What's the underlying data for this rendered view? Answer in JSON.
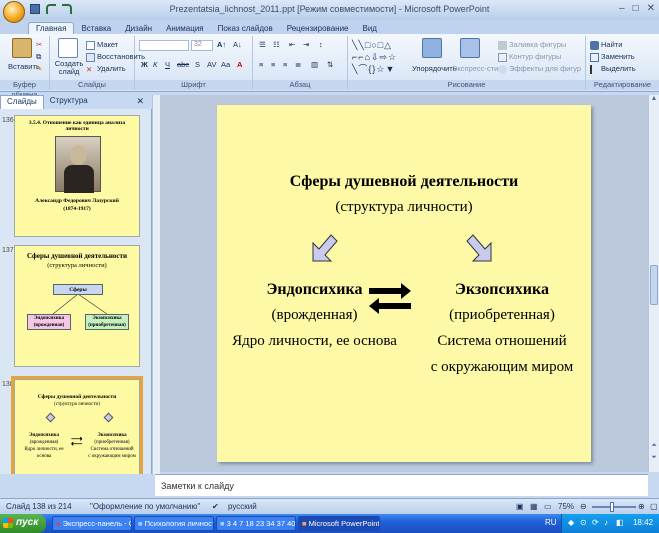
{
  "window": {
    "title": "Prezentatsia_lichnost_2011.ppt [Режим совместимости] - Microsoft PowerPoint",
    "controls": [
      "–",
      "□",
      "✕"
    ]
  },
  "ribbon": {
    "tabs": [
      "Главная",
      "Вставка",
      "Дизайн",
      "Анимация",
      "Показ слайдов",
      "Рецензирование",
      "Вид"
    ],
    "active_tab": "Главная",
    "clipboard": {
      "paste": "Вставить",
      "group": "Буфер обмена"
    },
    "slides": {
      "create": "Создать слайд",
      "layout": "Макет",
      "reset": "Восстановить",
      "delete": "Удалить",
      "group": "Слайды"
    },
    "font": {
      "size": "32",
      "group": "Шрифт"
    },
    "paragraph": {
      "group": "Абзац"
    },
    "drawing": {
      "arrange": "Упорядочить",
      "quick_styles": "Экспресс-стили",
      "fill": "Заливка фигуры",
      "outline": "Контур фигуры",
      "effects": "Эффекты для фигур",
      "group": "Рисование"
    },
    "editing": {
      "find": "Найти",
      "replace": "Заменить",
      "select": "Выделить",
      "group": "Редактирование"
    }
  },
  "panel": {
    "tabs": [
      "Слайды",
      "Структура"
    ],
    "active_tab": "Слайды"
  },
  "thumbnails": [
    {
      "number": "136",
      "title": "3.5.4. Отношение как единица анализа личности",
      "caption": "Александр Федорович Лазурский",
      "years": "(1874-1917)"
    },
    {
      "number": "137",
      "title": "Сферы душевной деятельности",
      "subtitle": "(структура личности)",
      "box_top": "Сферы",
      "box_left": "Эндопсихика (врожденная)",
      "box_right": "Экзопсихика (приобретенная)"
    },
    {
      "number": "138",
      "title": "Сферы душевной деятельности",
      "subtitle": "(структура личности)",
      "left_title": "Эндопсихика",
      "left_sub": "(врожденная)",
      "left_desc": "Ядро личности, ее основа",
      "right_title": "Экзопсихика",
      "right_sub": "(приобретенная)",
      "right_desc1": "Система отношений",
      "right_desc2": "с окружающим миром"
    }
  ],
  "slide": {
    "title": "Сферы душевной деятельности",
    "subtitle": "(структура личности)",
    "left": {
      "heading": "Эндопсихика",
      "sub": "(врожденная)",
      "desc": "Ядро личности, ее основа"
    },
    "right": {
      "heading": "Экзопсихика",
      "sub": "(приобретенная)",
      "desc1": "Система отношений",
      "desc2": "с окружающим миром"
    }
  },
  "notes": {
    "placeholder": "Заметки к слайду"
  },
  "status": {
    "slide": "Слайд 138 из 214",
    "theme": "\"Оформление по умолчанию\"",
    "language": "русский",
    "zoom": "75%"
  },
  "taskbar": {
    "start": "пуск",
    "items": [
      "Экспресс-панель - О...",
      "Психология личност...",
      "3 4 7 18 23 34 37 40 ...",
      "Microsoft PowerPoint ..."
    ],
    "active_item": 3,
    "lang": "RU",
    "clock": "18:42"
  },
  "colors": {
    "slide_bg": "#fdf9a6",
    "selected_thumb": "#e8a33a",
    "ribbon_bg": "#dbe8f7"
  }
}
